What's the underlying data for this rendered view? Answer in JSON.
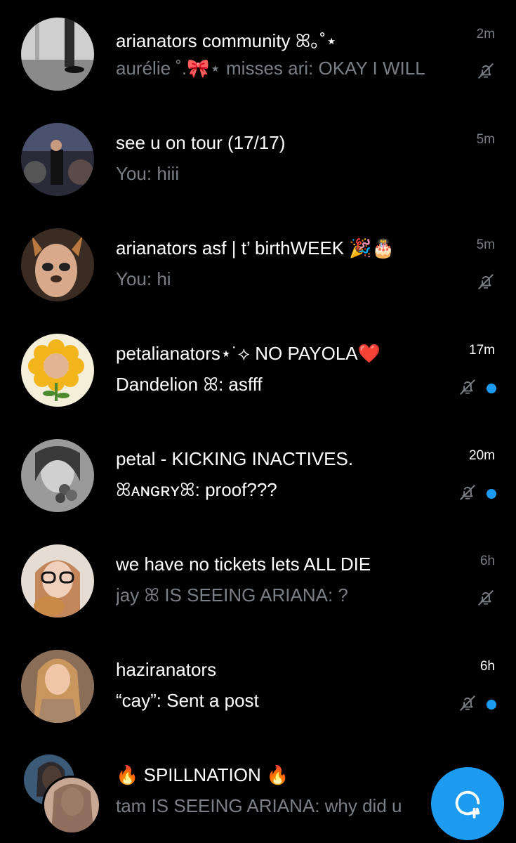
{
  "accent_color": "#1d9bf0",
  "conversations": [
    {
      "title": "arianators community ꕤ｡˚⋆",
      "preview": "aurélie ˚.🎀⋆ misses ari: OKAY I WILL",
      "time": "2m",
      "muted": true,
      "unread": false
    },
    {
      "title": "see u on tour (17/17)",
      "preview": "You: hiii",
      "time": "5m",
      "muted": false,
      "unread": false
    },
    {
      "title": "arianators asf | t’ birthWEEK 🎉🎂",
      "preview": "You: hi",
      "time": "5m",
      "muted": true,
      "unread": false
    },
    {
      "title": "petalianators⋆˙⟡ NO PAYOLA❤️",
      "preview": "Dandelion ꕤ: asfff",
      "time": "17m",
      "muted": true,
      "unread": true
    },
    {
      "title": "petal - KICKING INACTIVES.",
      "preview": "ꕤᴀɴɢʀʏꕤ: proof???",
      "time": "20m",
      "muted": true,
      "unread": true
    },
    {
      "title": "we have no tickets lets ALL DIE",
      "preview": "jay ꕤ IS SEEING ARIANA: ?",
      "time": "6h",
      "muted": true,
      "unread": false
    },
    {
      "title": "haziranators",
      "preview": "“cay”: Sent a post",
      "time": "6h",
      "muted": true,
      "unread": true
    },
    {
      "title": "🔥 SPILLNATION 🔥",
      "preview": "tam IS SEEING ARIANA: why did u",
      "time": "",
      "muted": false,
      "unread": false
    }
  ],
  "icons": {
    "mute": "bell-slash-icon",
    "new_message": "new-message-icon"
  }
}
